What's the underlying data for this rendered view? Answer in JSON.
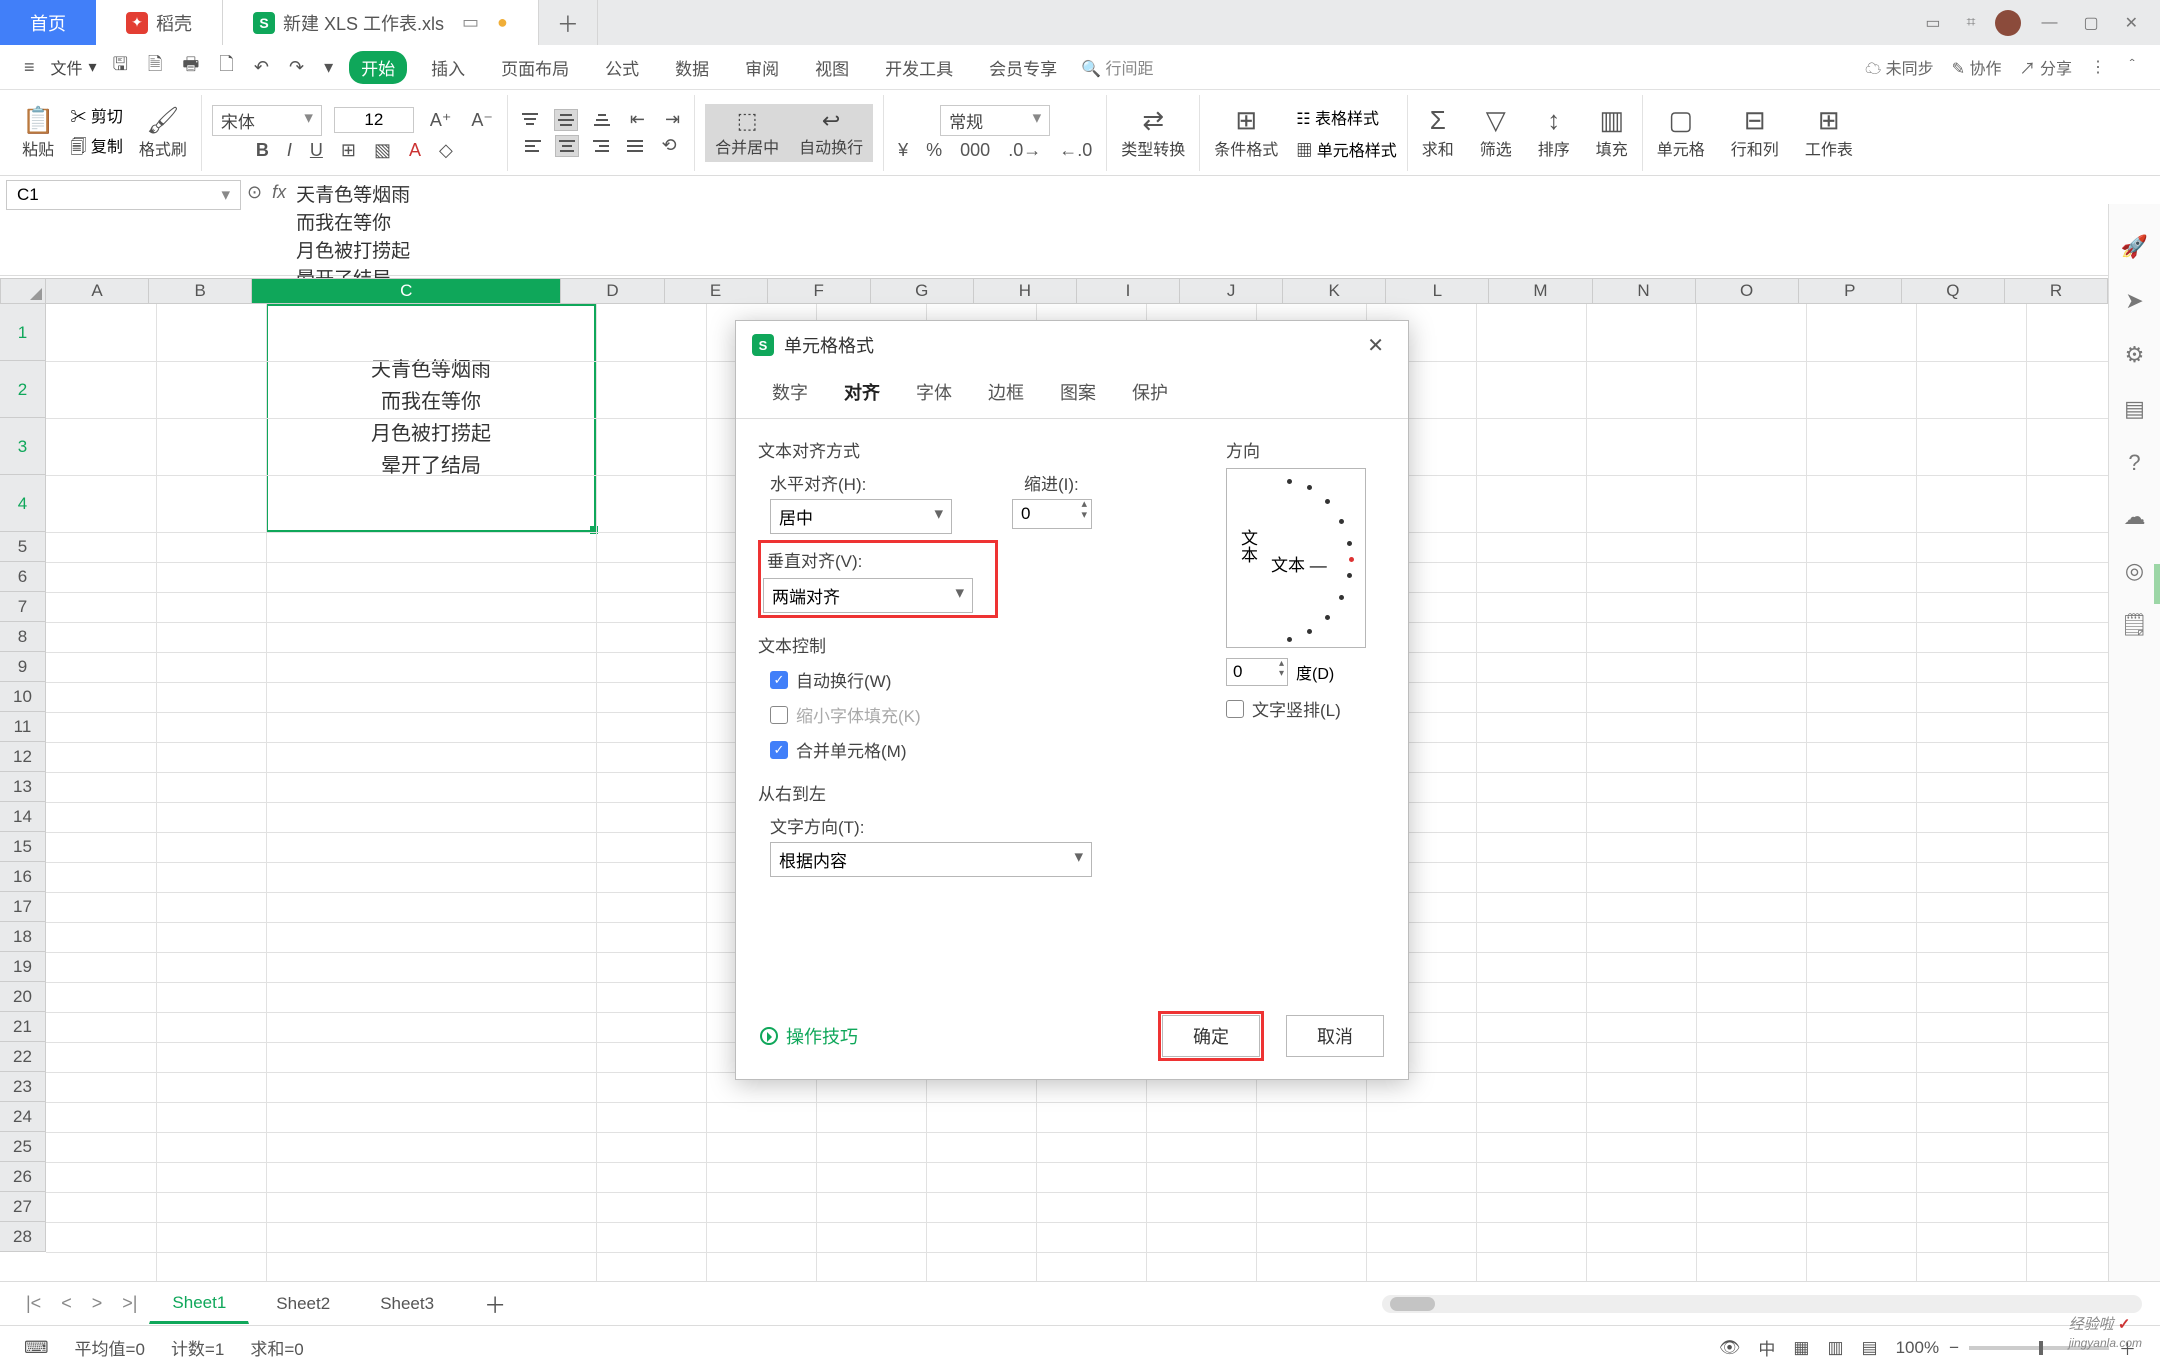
{
  "tabs": {
    "home": "首页",
    "dao": "稻壳",
    "sheet": "新建 XLS 工作表.xls"
  },
  "menu": {
    "file": "文件",
    "items": [
      "开始",
      "插入",
      "页面布局",
      "公式",
      "数据",
      "审阅",
      "视图",
      "开发工具",
      "会员专享"
    ],
    "search": "行间距",
    "right": {
      "unsync": "未同步",
      "collab": "协作",
      "share": "分享"
    }
  },
  "ribbon": {
    "paste": "粘贴",
    "cut": "剪切",
    "copy": "复制",
    "brush": "格式刷",
    "font": "宋体",
    "size": "12",
    "mergecenter": "合并居中",
    "wrap": "自动换行",
    "numfmt": "常规",
    "typeconv": "类型转换",
    "condfmt": "条件格式",
    "tablestyle": "表格样式",
    "cellstyle": "单元格样式",
    "sum": "求和",
    "filter": "筛选",
    "sort": "排序",
    "fill": "填充",
    "cells": "单元格",
    "rowcol": "行和列",
    "worksheet": "工作表"
  },
  "namebox": "C1",
  "fx": [
    "天青色等烟雨",
    "而我在等你",
    "月色被打捞起",
    "晕开了结局"
  ],
  "cell": [
    "天青色等烟雨",
    "而我在等你",
    "月色被打捞起",
    "晕开了结局"
  ],
  "cols": [
    "A",
    "B",
    "C",
    "D",
    "E",
    "F",
    "G",
    "H",
    "I",
    "J",
    "K",
    "L",
    "M",
    "N",
    "O",
    "P",
    "Q",
    "R"
  ],
  "sheets": [
    "Sheet1",
    "Sheet2",
    "Sheet3"
  ],
  "status": {
    "avg": "平均值=0",
    "cnt": "计数=1",
    "sum": "求和=0",
    "zoom": "100%"
  },
  "dialog": {
    "title": "单元格格式",
    "tabs": [
      "数字",
      "对齐",
      "字体",
      "边框",
      "图案",
      "保护"
    ],
    "text_align": "文本对齐方式",
    "halign_l": "水平对齐(H):",
    "halign_v": "居中",
    "indent_l": "缩进(I):",
    "indent_v": "0",
    "valign_l": "垂直对齐(V):",
    "valign_v": "两端对齐",
    "text_ctrl": "文本控制",
    "wrap": "自动换行(W)",
    "shrink": "缩小字体填充(K)",
    "merge": "合并单元格(M)",
    "rtl": "从右到左",
    "dir_l": "文字方向(T):",
    "dir_v": "根据内容",
    "orient": "方向",
    "orient_txt": "文本",
    "deg_v": "0",
    "deg_l": "度(D)",
    "vert": "文字竖排(L)",
    "tips": "操作技巧",
    "ok": "确定",
    "cancel": "取消"
  },
  "watermark": "经验啦",
  "watermark_url": "jingyanla.com"
}
